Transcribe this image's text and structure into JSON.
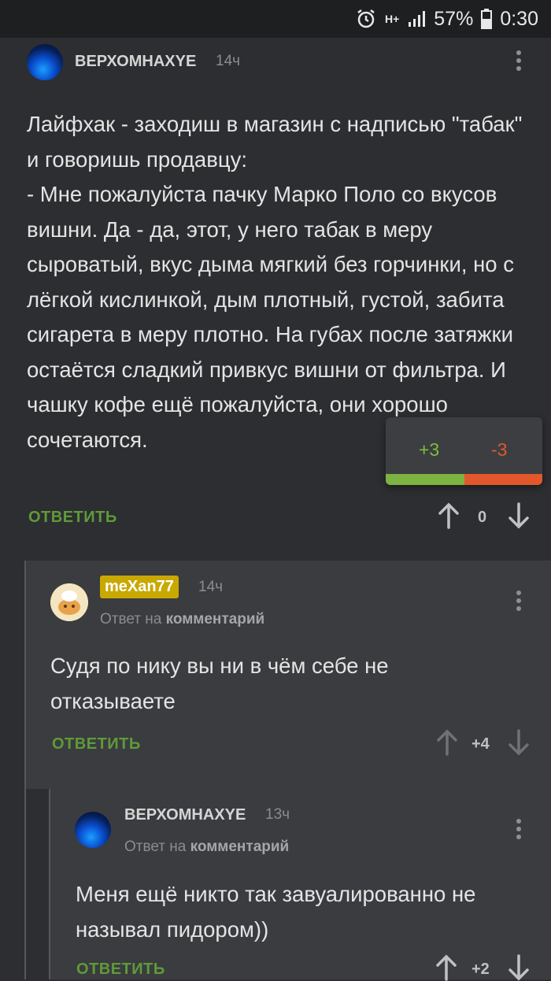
{
  "status_bar": {
    "alarm_icon": "alarm-clock-icon",
    "network": "H+",
    "signal_icon": "signal-bars-icon",
    "battery_percent": "57%",
    "battery_icon": "battery-icon",
    "time": "0:30"
  },
  "main_comment": {
    "username": "ВЕРХОМНАХYЕ",
    "time": "14ч",
    "text": "Лайфхак - заходиш в магазин с надписью \"табак\" и говоришь продавцу:\n- Мне пожалуйста пачку Марко Поло со вкусов вишни. Да - да, этот, у него табак в меру сыроватый, вкус дыма мягкий без горчинки, но с лёгкой кислинкой, дым плотный, густой, забита сигарета в меру плотно. На губах после затяжки остаётся сладкий привкус вишни от фильтра. И чашку кофе ещё пожалуйста, они хорошо сочетаются.",
    "reply_label": "ОТВЕТИТЬ",
    "score": "0"
  },
  "vote_popup": {
    "plus": "+3",
    "minus": "-3",
    "plus_share": 0.5,
    "colors": {
      "plus": "#7cb342",
      "minus": "#e2572c"
    }
  },
  "reply_1": {
    "username": "meXan77",
    "time": "14ч",
    "reply_to_prefix": "Ответ на",
    "reply_to_target": "комментарий",
    "text": "Судя по нику вы ни в чём себе не отказываете",
    "reply_label": "ОТВЕТИТЬ",
    "score": "+4"
  },
  "reply_2": {
    "username": "ВЕРХОМНАХYЕ",
    "time": "13ч",
    "reply_to_prefix": "Ответ на",
    "reply_to_target": "комментарий",
    "text": "Меня ещё никто так завуалированно не называл пидором))",
    "reply_label": "ОТВЕТИТЬ",
    "score": "+2"
  },
  "colors": {
    "background": "#2c2e31",
    "reply_background": "#3a3c3f",
    "reply_button": "#5f9a3a",
    "username_badge": "#c9a800"
  }
}
